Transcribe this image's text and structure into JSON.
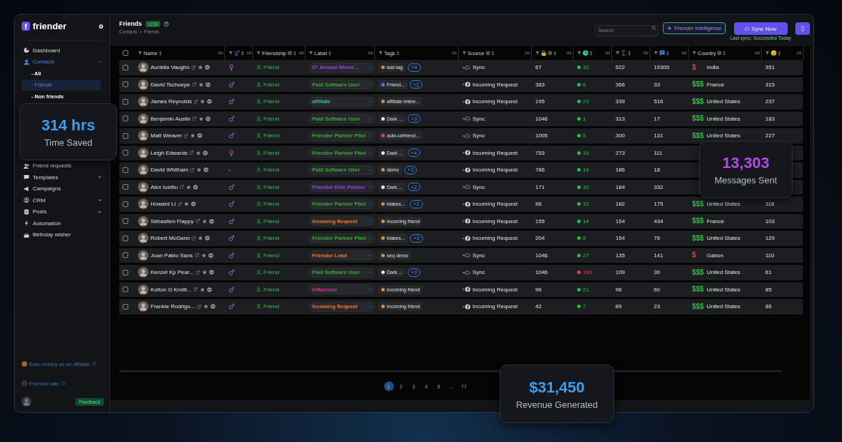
{
  "sidebar": {
    "logo_letter": "f",
    "brand": "friender",
    "nav": [
      {
        "label": "Dashboard",
        "selected": false
      },
      {
        "label": "Contacts",
        "selected": true,
        "expanded": true,
        "children": [
          {
            "label": "- All",
            "selected": false
          },
          {
            "label": "- Friends",
            "selected": true
          },
          {
            "label": "- Non friends",
            "selected": false
          }
        ]
      },
      {
        "label": "Friend requests",
        "selected": false
      },
      {
        "label": "Templates",
        "selected": false,
        "expanded": false
      },
      {
        "label": "Campaigns",
        "selected": false
      },
      {
        "label": "CRM",
        "selected": false,
        "expanded": false
      },
      {
        "label": "Posts",
        "selected": false,
        "expanded": false
      },
      {
        "label": "Automation",
        "selected": false
      },
      {
        "label": "Birthday wisher",
        "selected": false
      }
    ],
    "affiliate_link": "Earn money as an affiliate",
    "wiki_link": "Friender wiki",
    "feedback_button": "Feedback"
  },
  "header": {
    "title": "Friends",
    "count": "1158",
    "breadcrumb": [
      "Contacts",
      ">",
      "Friends"
    ],
    "search": {
      "placeholder": "Search"
    },
    "intelligence_button": "Friender Intelligence",
    "sync_button": "Sync Now",
    "sync_status": "Last sync: Successful Today"
  },
  "table": {
    "columns": [
      {
        "kind": "checkbox",
        "checked": false
      },
      {
        "kind": "text",
        "label": "Name"
      },
      {
        "kind": "icon"
      },
      {
        "kind": "text",
        "label": "Friendship",
        "help": true
      },
      {
        "kind": "text",
        "label": "Label"
      },
      {
        "kind": "text",
        "label": "Tags"
      },
      {
        "kind": "text",
        "label": "Source",
        "help": true
      },
      {
        "kind": "icon",
        "help": true
      },
      {
        "kind": "icon"
      },
      {
        "kind": "icon"
      },
      {
        "kind": "icon"
      },
      {
        "kind": "text",
        "label": "Country",
        "help": true
      },
      {
        "kind": "icon"
      }
    ],
    "rows": [
      {
        "checked": false,
        "name": "Aunkita Vaughn",
        "gender": {
          "kind": "female"
        },
        "friendship": "Friend",
        "label": {
          "text": "D* Annual Winne...",
          "color": "#9b45d6"
        },
        "tag": {
          "text": "last-tag",
          "color": "#f08a24"
        },
        "more_tags": "+4",
        "source": {
          "kind": "sync",
          "text": "Sync"
        },
        "column_7": "67",
        "activity": {
          "text": "10",
          "color": "#2fbf3f"
        },
        "column_9": "522",
        "messages": "19305",
        "wealth": {
          "text": "$",
          "color": "#e0405a"
        },
        "country": "India",
        "column_12": "351"
      },
      {
        "checked": false,
        "name": "David Tschoepe",
        "gender": {
          "kind": "male"
        },
        "friendship": "Friend",
        "label": {
          "text": "Paid Software User",
          "color": "#3fa83a"
        },
        "tag": {
          "text": "Friend...",
          "color": "#3b82f6"
        },
        "more_tags": "+1",
        "source": {
          "kind": "incoming",
          "text": "Incoming Request"
        },
        "column_7": "383",
        "activity": {
          "text": "6",
          "color": "#2fbf3f"
        },
        "column_9": "366",
        "messages": "33",
        "wealth": {
          "text": "$$$",
          "color": "#2fbf3f"
        },
        "country": "France",
        "column_12": "315"
      },
      {
        "checked": false,
        "name": "James Reynolds",
        "gender": {
          "kind": "male"
        },
        "friendship": "Friend",
        "label": {
          "text": "affiliate",
          "color": "#3fb8a8"
        },
        "tag": {
          "text": "affiliate intere...",
          "color": "#f08a24"
        },
        "source": {
          "kind": "incoming",
          "text": "Incoming Request"
        },
        "column_7": "195",
        "activity": {
          "text": "23",
          "color": "#2fbf3f"
        },
        "column_9": "339",
        "messages": "516",
        "wealth": {
          "text": "$$$",
          "color": "#2fbf3f"
        },
        "country": "United States",
        "column_12": "237"
      },
      {
        "checked": false,
        "name": "Benjamin Austin",
        "gender": {
          "kind": "male"
        },
        "friendship": "Friend",
        "label": {
          "text": "Paid Software User",
          "color": "#3fa83a"
        },
        "tag": {
          "text": "Dark ...",
          "color": "#e8e8e8"
        },
        "more_tags": "+3",
        "source": {
          "kind": "sync",
          "text": "Sync"
        },
        "column_7": "1046",
        "activity": {
          "text": "1",
          "color": "#2fbf3f"
        },
        "column_9": "313",
        "messages": "17",
        "wealth": {
          "text": "$$$",
          "color": "#2fbf3f"
        },
        "country": "United States",
        "column_12": "183"
      },
      {
        "checked": false,
        "name": "Matt Weaver",
        "gender": {
          "kind": "male"
        },
        "friendship": "Friend",
        "label": {
          "text": "Friender Partner Pilot",
          "color": "#3fa83a"
        },
        "tag": {
          "text": "auto-unfriend...",
          "color": "#e83a7a"
        },
        "source": {
          "kind": "sync",
          "text": "Sync"
        },
        "column_7": "1005",
        "activity": {
          "text": "5",
          "color": "#2fbf3f"
        },
        "column_9": "300",
        "messages": "131",
        "wealth": {
          "text": "$$$",
          "color": "#2fbf3f"
        },
        "country": "United States",
        "column_12": "227"
      },
      {
        "checked": false,
        "name": "Leigh Edwards",
        "gender": {
          "kind": "female"
        },
        "friendship": "Friend",
        "label": {
          "text": "Friender Partner Pilot",
          "color": "#3fa83a"
        },
        "tag": {
          "text": "Dark ...",
          "color": "#e8e8e8"
        },
        "more_tags": "+4",
        "source": {
          "kind": "incoming",
          "text": "Incoming Request"
        },
        "column_7": "753",
        "activity": {
          "text": "16",
          "color": "#2fbf3f"
        },
        "column_9": "273",
        "messages": "111"
      },
      {
        "checked": false,
        "name": "David Whitham",
        "gender": {
          "kind": "text",
          "text": "-"
        },
        "friendship": "Friend",
        "label": {
          "text": "Paid Software User",
          "color": "#3fa83a"
        },
        "tag": {
          "text": "demo",
          "color": "#f08a24"
        },
        "more_tags": "+3",
        "source": {
          "kind": "incoming",
          "text": "Incoming Request"
        },
        "column_7": "786",
        "activity": {
          "text": "14",
          "color": "#2fbf3f"
        },
        "column_9": "186",
        "messages": "18"
      },
      {
        "checked": false,
        "name": "Alex Iustitu",
        "gender": {
          "kind": "male"
        },
        "friendship": "Friend",
        "label": {
          "text": "Friender Elite Partner",
          "color": "#9b45d6"
        },
        "tag": {
          "text": "Dark ...",
          "color": "#e8e8e8"
        },
        "more_tags": "+2",
        "source": {
          "kind": "sync",
          "text": "Sync"
        },
        "column_7": "171",
        "activity": {
          "text": "10",
          "color": "#2fbf3f"
        },
        "column_9": "184",
        "messages": "332"
      },
      {
        "checked": false,
        "name": "Howard Li",
        "gender": {
          "kind": "male"
        },
        "friendship": "Friend",
        "label": {
          "text": "Friender Partner Pilot",
          "color": "#3fa83a"
        },
        "tag": {
          "text": "blakes...",
          "color": "#f08a24"
        },
        "more_tags": "+2",
        "source": {
          "kind": "incoming",
          "text": "Incoming Request"
        },
        "column_7": "96",
        "activity": {
          "text": "10",
          "color": "#2fbf3f"
        },
        "column_9": "182",
        "messages": "175",
        "wealth": {
          "text": "$$$",
          "color": "#2fbf3f"
        },
        "country": "United States",
        "column_12": "118"
      },
      {
        "checked": false,
        "name": "Sébastien Flappy",
        "gender": {
          "kind": "male"
        },
        "friendship": "Friend",
        "label": {
          "text": "Incoming Request",
          "color": "#f07a24"
        },
        "tag": {
          "text": "incoming friend",
          "color": "#f08a24"
        },
        "source": {
          "kind": "incoming",
          "text": "Incoming Request"
        },
        "column_7": "155",
        "activity": {
          "text": "14",
          "color": "#2fbf3f"
        },
        "column_9": "154",
        "messages": "434",
        "wealth": {
          "text": "$$$",
          "color": "#2fbf3f"
        },
        "country": "France",
        "column_12": "103"
      },
      {
        "checked": false,
        "name": "Robert McGann",
        "gender": {
          "kind": "male"
        },
        "friendship": "Friend",
        "label": {
          "text": "Friender Partner Pilot",
          "color": "#3fa83a"
        },
        "tag": {
          "text": "blakes...",
          "color": "#f08a24"
        },
        "more_tags": "+3",
        "source": {
          "kind": "incoming",
          "text": "Incoming Request"
        },
        "column_7": "204",
        "activity": {
          "text": "8",
          "color": "#2fbf3f"
        },
        "column_9": "154",
        "messages": "76",
        "wealth": {
          "text": "$$$",
          "color": "#2fbf3f"
        },
        "country": "United States",
        "column_12": "129"
      },
      {
        "checked": false,
        "name": "Juan Pablo Sans",
        "gender": {
          "kind": "male"
        },
        "friendship": "Friend",
        "label": {
          "text": "Friender Lead",
          "color": "#f07a24"
        },
        "tag": {
          "text": "seq demo",
          "color": "#f08a24"
        },
        "source": {
          "kind": "sync",
          "text": "Sync"
        },
        "column_7": "1046",
        "activity": {
          "text": "27",
          "color": "#2fbf3f"
        },
        "column_9": "135",
        "messages": "141",
        "wealth": {
          "text": "$",
          "color": "#e0405a"
        },
        "country": "Gabon",
        "column_12": "110"
      },
      {
        "checked": false,
        "name": "Kenzel Kp Pear...",
        "gender": {
          "kind": "male"
        },
        "friendship": "Friend",
        "label": {
          "text": "Paid Software User",
          "color": "#3fa83a"
        },
        "tag": {
          "text": "Dark ...",
          "color": "#e8e8e8"
        },
        "more_tags": "+3",
        "source": {
          "kind": "sync",
          "text": "Sync"
        },
        "column_7": "1046",
        "activity": {
          "text": "189",
          "color": "#e0405a"
        },
        "column_9": "109",
        "messages": "30",
        "wealth": {
          "text": "$$$",
          "color": "#2fbf3f"
        },
        "country": "United States",
        "column_12": "61"
      },
      {
        "checked": false,
        "name": "Kolton G Krottl...",
        "gender": {
          "kind": "male"
        },
        "friendship": "Friend",
        "label": {
          "text": "Influencer",
          "color": "#d63a9a"
        },
        "tag": {
          "text": "incoming friend",
          "color": "#f08a24"
        },
        "source": {
          "kind": "incoming",
          "text": "Incoming Request"
        },
        "column_7": "96",
        "activity": {
          "text": "21",
          "color": "#2fbf3f"
        },
        "column_9": "96",
        "messages": "60",
        "wealth": {
          "text": "$$$",
          "color": "#2fbf3f"
        },
        "country": "United States",
        "column_12": "85"
      },
      {
        "checked": false,
        "name": "Frankie Rodrigu...",
        "gender": {
          "kind": "male"
        },
        "friendship": "Friend",
        "label": {
          "text": "Incoming Request",
          "color": "#f07a24"
        },
        "tag": {
          "text": "incoming friend",
          "color": "#f08a24"
        },
        "source": {
          "kind": "incoming",
          "text": "Incoming Request"
        },
        "column_7": "42",
        "activity": {
          "text": "7",
          "color": "#2fbf3f"
        },
        "column_9": "89",
        "messages": "23",
        "wealth": {
          "text": "$$$",
          "color": "#2fbf3f"
        },
        "country": "United States",
        "column_12": "86"
      }
    ]
  },
  "pagination": [
    {
      "label": "1",
      "selected": true
    },
    {
      "label": "2",
      "selected": false
    },
    {
      "label": "3",
      "selected": false
    },
    {
      "label": "4",
      "selected": false
    },
    {
      "label": "5",
      "selected": false
    },
    {
      "label": "...",
      "selected": false
    },
    {
      "label": "77",
      "selected": false
    }
  ],
  "stats": [
    {
      "value": "314 hrs",
      "label": "Time Saved",
      "color": "#3b9ef0"
    },
    {
      "value": "13,303",
      "label": "Messages Sent",
      "color": "#b24ee8"
    },
    {
      "value": "$31,450",
      "label": "Revenue Generated",
      "color": "#3b9ef0"
    }
  ]
}
